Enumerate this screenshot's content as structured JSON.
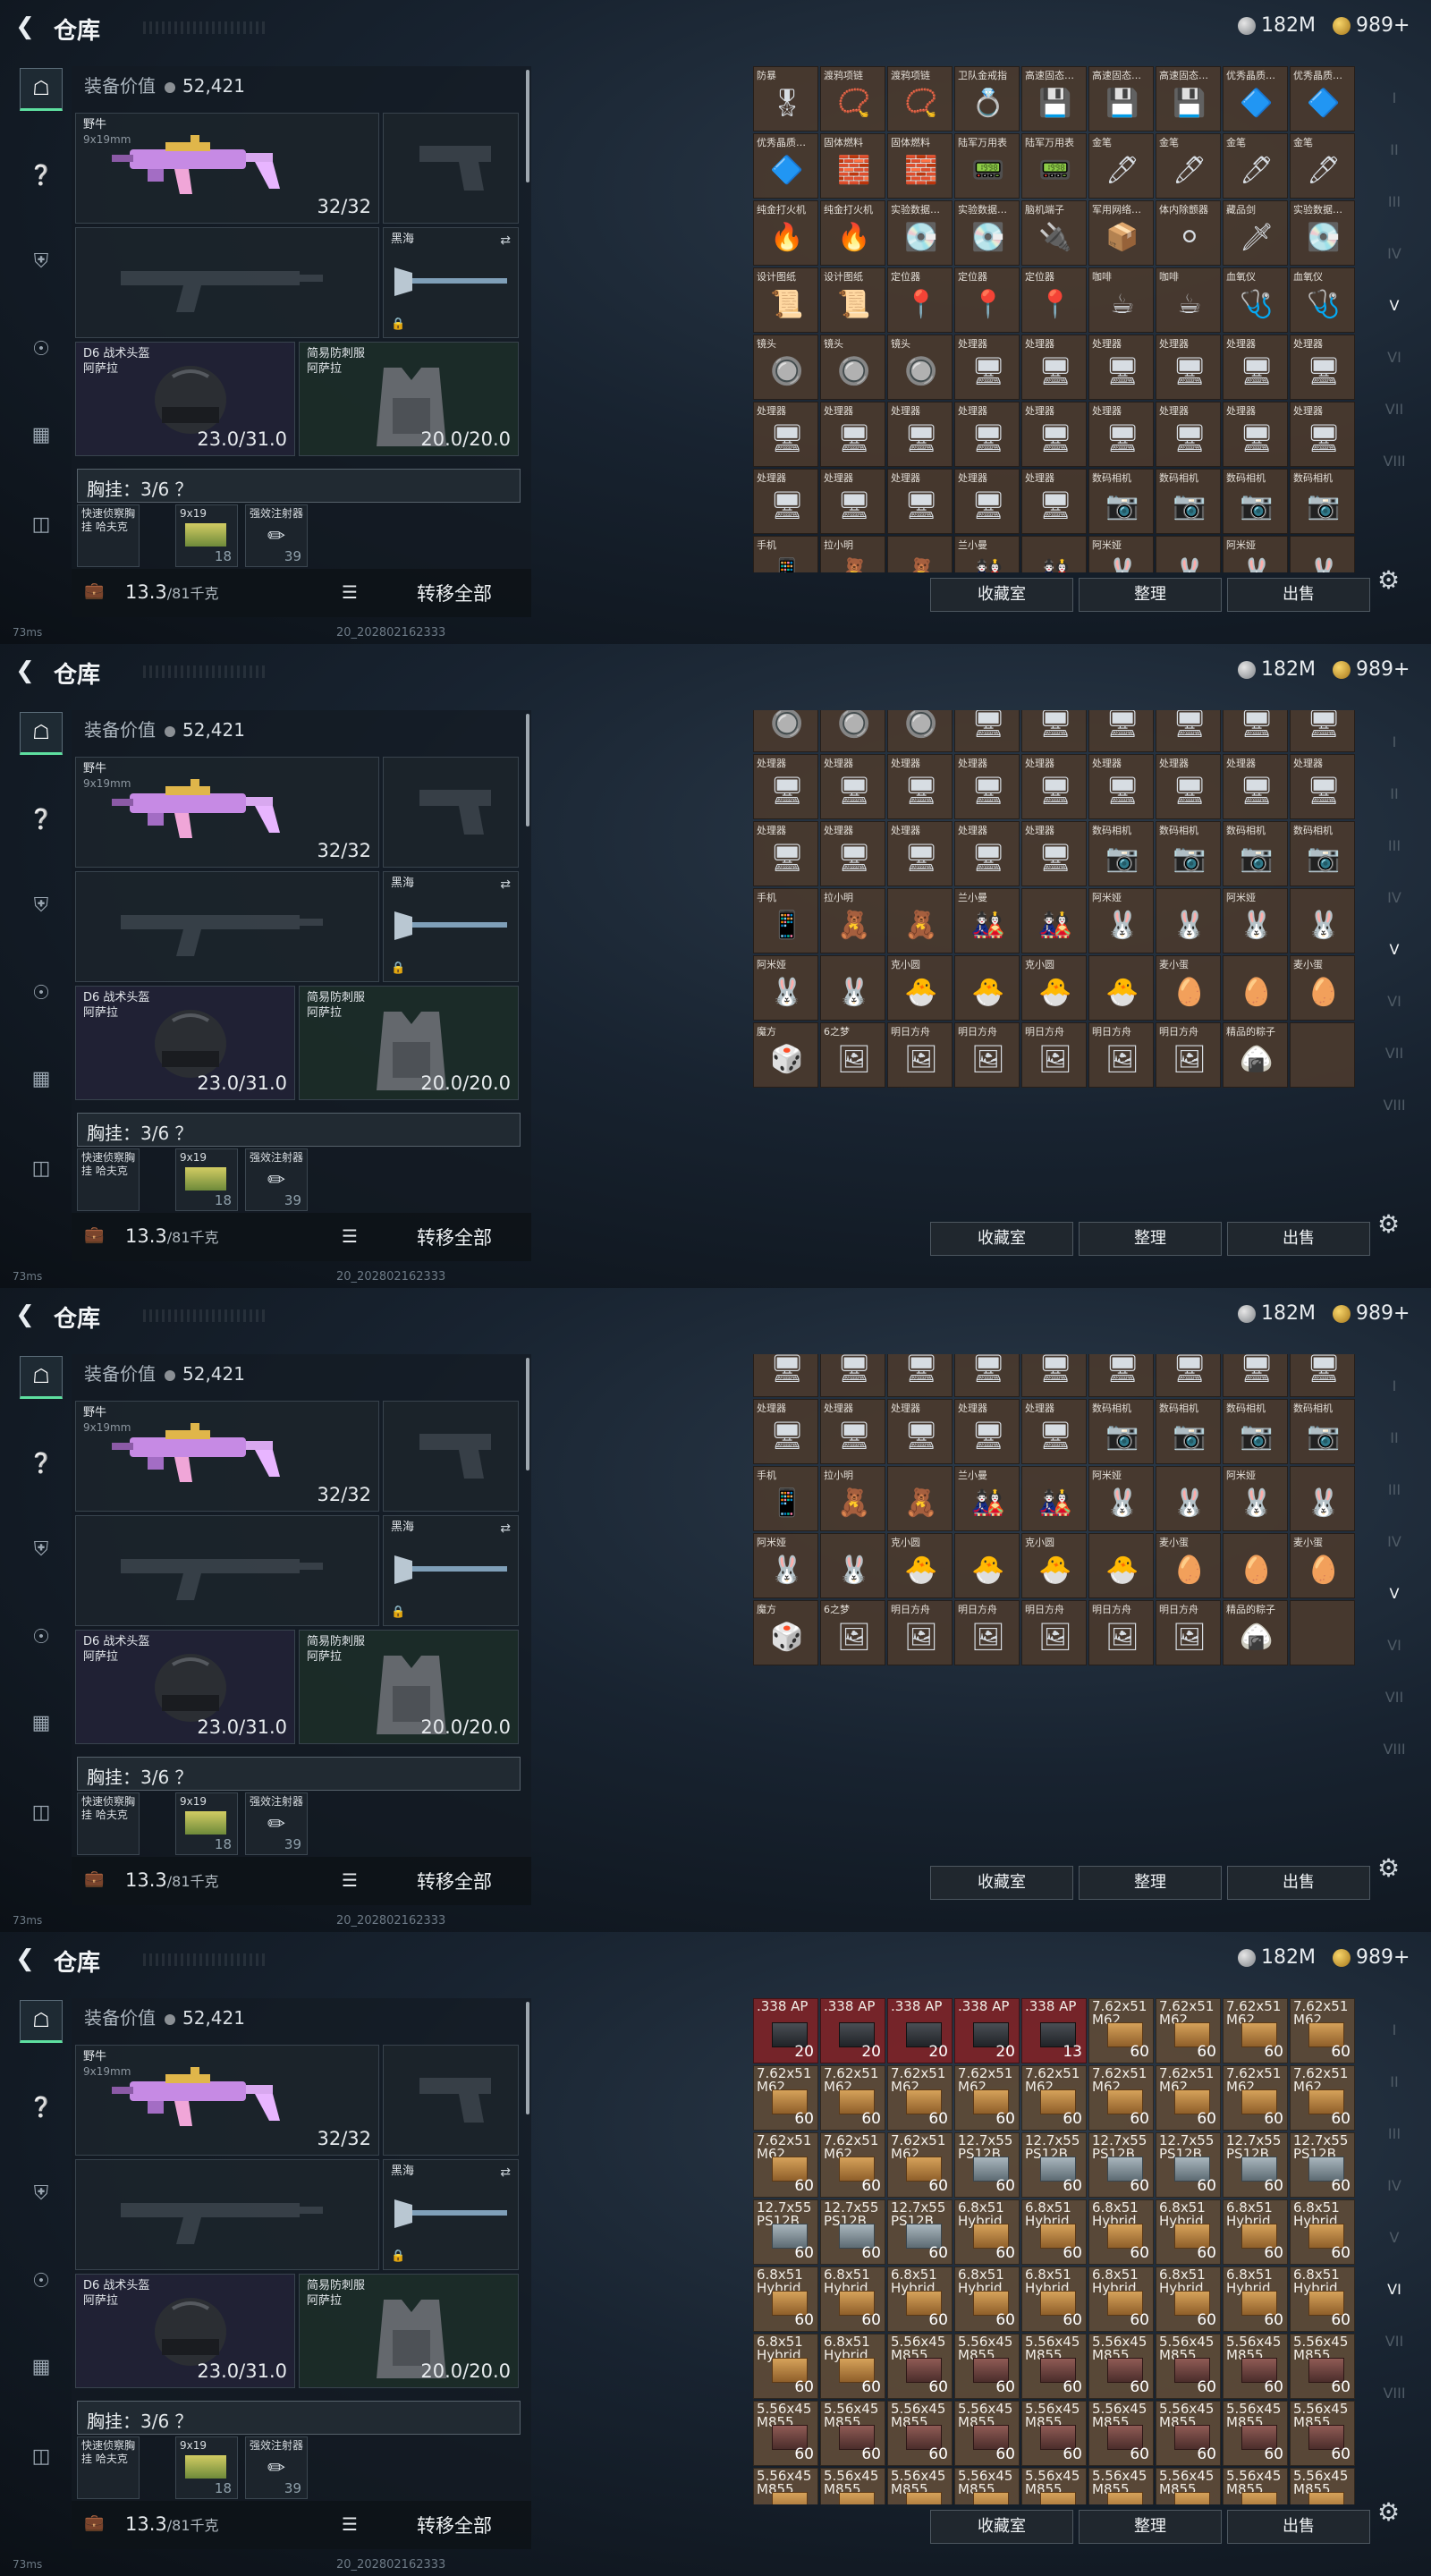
{
  "screens": [
    {
      "id": "s1"
    },
    {
      "id": "s2"
    },
    {
      "id": "s3"
    },
    {
      "id": "s4"
    }
  ],
  "header": {
    "title": "仓库",
    "silver": "182M",
    "gold": "989+"
  },
  "loadout": {
    "value_label": "装备价值",
    "value": "52,421",
    "primary": {
      "name": "野牛",
      "sub": "9x19mm",
      "ammo": "32/32"
    },
    "melee": {
      "name": "黑海"
    },
    "helmet": {
      "name": "D6 战术头盔",
      "sub": "阿萨拉",
      "durability": "23.0/31.0"
    },
    "armor": {
      "name": "简易防刺服",
      "sub": "阿萨拉",
      "durability": "20.0/20.0"
    },
    "chest": "胸挂：3/6 ？",
    "pouches": [
      {
        "name": "快速侦察胸挂 哈夫克",
        "count": ""
      },
      {
        "name": "9x19",
        "count": "18"
      },
      {
        "name": "强效注射器",
        "count": "39"
      }
    ],
    "weight": "13.3",
    "weight_unit": "/81千克",
    "transfer_all": "转移全部"
  },
  "actions": {
    "collection": "收藏室",
    "sort": "整理",
    "sell": "出售"
  },
  "status": {
    "ping": "73ms",
    "build": "20_202802162333"
  },
  "grid1_rows": [
    [
      [
        "防暴",
        "🎖"
      ],
      [
        "渡鸦项链",
        "📿"
      ],
      [
        "渡鸦项链",
        "📿"
      ],
      [
        "卫队金戒指",
        "💍"
      ],
      [
        "高速固态…",
        "💾"
      ],
      [
        "高速固态…",
        "💾"
      ],
      [
        "高速固态…",
        "💾"
      ],
      [
        "优秀晶质…",
        "🔷"
      ],
      [
        "优秀晶质…",
        "🔷"
      ]
    ],
    [
      [
        "优秀晶质…",
        "🔷"
      ],
      [
        "固体燃料",
        "🧱"
      ],
      [
        "固体燃料",
        "🧱"
      ],
      [
        "陆军万用表",
        "📟"
      ],
      [
        "陆军万用表",
        "📟"
      ],
      [
        "金笔",
        "🖊"
      ],
      [
        "金笔",
        "🖊"
      ],
      [
        "金笔",
        "🖊"
      ],
      [
        "金笔",
        "🖊"
      ]
    ],
    [
      [
        "纯金打火机",
        "🔥"
      ],
      [
        "纯金打火机",
        "🔥"
      ],
      [
        "实验数据…",
        "💽"
      ],
      [
        "实验数据…",
        "💽"
      ],
      [
        "脑机端子",
        "🔌"
      ],
      [
        "军用网络…",
        "📦"
      ],
      [
        "体内除颤器",
        "⚪"
      ],
      [
        "藏品剑",
        "🗡"
      ],
      [
        "实验数据…",
        "💽"
      ]
    ],
    [
      [
        "设计图纸",
        "📜"
      ],
      [
        "设计图纸",
        "📜"
      ],
      [
        "定位器",
        "📍"
      ],
      [
        "定位器",
        "📍"
      ],
      [
        "定位器",
        "📍"
      ],
      [
        "咖啡",
        "☕"
      ],
      [
        "咖啡",
        "☕"
      ],
      [
        "血氧仪",
        "🩺"
      ],
      [
        "血氧仪",
        "🩺"
      ]
    ],
    [
      [
        "镜头",
        "🔘"
      ],
      [
        "镜头",
        "🔘"
      ],
      [
        "镜头",
        "🔘"
      ],
      [
        "处理器",
        "🖥"
      ],
      [
        "处理器",
        "🖥"
      ],
      [
        "处理器",
        "🖥"
      ],
      [
        "处理器",
        "🖥"
      ],
      [
        "处理器",
        "🖥"
      ],
      [
        "处理器",
        "🖥"
      ]
    ],
    [
      [
        "处理器",
        "🖥"
      ],
      [
        "处理器",
        "🖥"
      ],
      [
        "处理器",
        "🖥"
      ],
      [
        "处理器",
        "🖥"
      ],
      [
        "处理器",
        "🖥"
      ],
      [
        "处理器",
        "🖥"
      ],
      [
        "处理器",
        "🖥"
      ],
      [
        "处理器",
        "🖥"
      ],
      [
        "处理器",
        "🖥"
      ]
    ],
    [
      [
        "处理器",
        "🖥"
      ],
      [
        "处理器",
        "🖥"
      ],
      [
        "处理器",
        "🖥"
      ],
      [
        "处理器",
        "🖥"
      ],
      [
        "处理器",
        "🖥"
      ],
      [
        "数码相机",
        "📷"
      ],
      [
        "数码相机",
        "📷"
      ],
      [
        "数码相机",
        "📷"
      ],
      [
        "数码相机",
        "📷"
      ]
    ],
    [
      [
        "手机",
        "📱"
      ],
      [
        "拉小明",
        "🧸"
      ],
      [
        "",
        "🧸"
      ],
      [
        "兰小曼",
        "🎎"
      ],
      [
        "",
        "🎎"
      ],
      [
        "阿米娅",
        "🐰"
      ],
      [
        "",
        "🐰"
      ],
      [
        "阿米娅",
        "🐰"
      ],
      [
        "",
        "🐰"
      ]
    ]
  ],
  "grid2_rows": [
    [
      [
        "镜头",
        "🔘"
      ],
      [
        "镜头",
        "🔘"
      ],
      [
        "镜头",
        "🔘"
      ],
      [
        "处理器",
        "🖥"
      ],
      [
        "处理器",
        "🖥"
      ],
      [
        "处理器",
        "🖥"
      ],
      [
        "处理器",
        "🖥"
      ],
      [
        "处理器",
        "🖥"
      ],
      [
        "处理器",
        "🖥"
      ]
    ],
    [
      [
        "处理器",
        "🖥"
      ],
      [
        "处理器",
        "🖥"
      ],
      [
        "处理器",
        "🖥"
      ],
      [
        "处理器",
        "🖥"
      ],
      [
        "处理器",
        "🖥"
      ],
      [
        "处理器",
        "🖥"
      ],
      [
        "处理器",
        "🖥"
      ],
      [
        "处理器",
        "🖥"
      ],
      [
        "处理器",
        "🖥"
      ]
    ],
    [
      [
        "处理器",
        "🖥"
      ],
      [
        "处理器",
        "🖥"
      ],
      [
        "处理器",
        "🖥"
      ],
      [
        "处理器",
        "🖥"
      ],
      [
        "处理器",
        "🖥"
      ],
      [
        "数码相机",
        "📷"
      ],
      [
        "数码相机",
        "📷"
      ],
      [
        "数码相机",
        "📷"
      ],
      [
        "数码相机",
        "📷"
      ]
    ],
    [
      [
        "手机",
        "📱"
      ],
      [
        "拉小明",
        "🧸"
      ],
      [
        "",
        "🧸"
      ],
      [
        "兰小曼",
        "🎎"
      ],
      [
        "",
        "🎎"
      ],
      [
        "阿米娅",
        "🐰"
      ],
      [
        "",
        "🐰"
      ],
      [
        "阿米娅",
        "🐰"
      ],
      [
        "",
        "🐰"
      ]
    ],
    [
      [
        "阿米娅",
        "🐰"
      ],
      [
        "",
        "🐰"
      ],
      [
        "克小圆",
        "🐣"
      ],
      [
        "",
        "🐣"
      ],
      [
        "克小圆",
        "🐣"
      ],
      [
        "",
        "🐣"
      ],
      [
        "麦小蛋",
        "🥚"
      ],
      [
        "",
        "🥚"
      ],
      [
        "麦小蛋",
        "🥚"
      ]
    ],
    [
      [
        "魔方",
        "🎲"
      ],
      [
        "6之梦",
        "🖼"
      ],
      [
        "明日方舟",
        "🖼"
      ],
      [
        "明日方舟",
        "🖼"
      ],
      [
        "明日方舟",
        "🖼"
      ],
      [
        "明日方舟",
        "🖼"
      ],
      [
        "明日方舟",
        "🖼"
      ],
      [
        "精品的粽子",
        "🍙"
      ],
      [
        "",
        ""
      ]
    ]
  ],
  "grid4_rows": [
    [
      [
        ".338 AP",
        "20",
        "dark"
      ],
      [
        ".338 AP",
        "20",
        "dark"
      ],
      [
        ".338 AP",
        "20",
        "dark"
      ],
      [
        ".338 AP",
        "20",
        "dark"
      ],
      [
        ".338 AP",
        "13",
        "dark"
      ],
      [
        "7.62x51 M62",
        "60",
        ""
      ],
      [
        "7.62x51 M62",
        "60",
        ""
      ],
      [
        "7.62x51 M62",
        "60",
        ""
      ],
      [
        "7.62x51 M62",
        "60",
        ""
      ]
    ],
    [
      [
        "7.62x51 M62",
        "60",
        ""
      ],
      [
        "7.62x51 M62",
        "60",
        ""
      ],
      [
        "7.62x51 M62",
        "60",
        ""
      ],
      [
        "7.62x51 M62",
        "60",
        ""
      ],
      [
        "7.62x51 M62",
        "60",
        ""
      ],
      [
        "7.62x51 M62",
        "60",
        ""
      ],
      [
        "7.62x51 M62",
        "60",
        ""
      ],
      [
        "7.62x51 M62",
        "60",
        ""
      ],
      [
        "7.62x51 M62",
        "60",
        ""
      ]
    ],
    [
      [
        "7.62x51 M62",
        "60",
        ""
      ],
      [
        "7.62x51 M62",
        "60",
        ""
      ],
      [
        "7.62x51 M62",
        "60",
        ""
      ],
      [
        "12.7x55 PS12B",
        "60",
        "silver"
      ],
      [
        "12.7x55 PS12B",
        "60",
        "silver"
      ],
      [
        "12.7x55 PS12B",
        "60",
        "silver"
      ],
      [
        "12.7x55 PS12B",
        "60",
        "silver"
      ],
      [
        "12.7x55 PS12B",
        "60",
        "silver"
      ],
      [
        "12.7x55 PS12B",
        "60",
        "silver"
      ]
    ],
    [
      [
        "12.7x55 PS12B",
        "60",
        "silver"
      ],
      [
        "12.7x55 PS12B",
        "60",
        "silver"
      ],
      [
        "12.7x55 PS12B",
        "60",
        "silver"
      ],
      [
        "6.8x51 Hybrid",
        "60",
        ""
      ],
      [
        "6.8x51 Hybrid",
        "60",
        ""
      ],
      [
        "6.8x51 Hybrid",
        "60",
        ""
      ],
      [
        "6.8x51 Hybrid",
        "60",
        ""
      ],
      [
        "6.8x51 Hybrid",
        "60",
        ""
      ],
      [
        "6.8x51 Hybrid",
        "60",
        ""
      ]
    ],
    [
      [
        "6.8x51 Hybrid",
        "60",
        ""
      ],
      [
        "6.8x51 Hybrid",
        "60",
        ""
      ],
      [
        "6.8x51 Hybrid",
        "60",
        ""
      ],
      [
        "6.8x51 Hybrid",
        "60",
        ""
      ],
      [
        "6.8x51 Hybrid",
        "60",
        ""
      ],
      [
        "6.8x51 Hybrid",
        "60",
        ""
      ],
      [
        "6.8x51 Hybrid",
        "60",
        ""
      ],
      [
        "6.8x51 Hybrid",
        "60",
        ""
      ],
      [
        "6.8x51 Hybrid",
        "60",
        ""
      ]
    ],
    [
      [
        "6.8x51 Hybrid",
        "60",
        ""
      ],
      [
        "6.8x51 Hybrid",
        "60",
        ""
      ],
      [
        "5.56x45 M855",
        "60",
        "red"
      ],
      [
        "5.56x45 M855",
        "60",
        "red"
      ],
      [
        "5.56x45 M855",
        "60",
        "red"
      ],
      [
        "5.56x45 M855",
        "60",
        "red"
      ],
      [
        "5.56x45 M855",
        "60",
        "red"
      ],
      [
        "5.56x45 M855",
        "60",
        "red"
      ],
      [
        "5.56x45 M855",
        "60",
        "red"
      ]
    ],
    [
      [
        "5.56x45 M855",
        "60",
        "red"
      ],
      [
        "5.56x45 M855",
        "60",
        "red"
      ],
      [
        "5.56x45 M855",
        "60",
        "red"
      ],
      [
        "5.56x45 M855",
        "60",
        "red"
      ],
      [
        "5.56x45 M855",
        "60",
        "red"
      ],
      [
        "5.56x45 M855",
        "60",
        "red"
      ],
      [
        "5.56x45 M855",
        "60",
        "red"
      ],
      [
        "5.56x45 M855",
        "60",
        "red"
      ],
      [
        "5.56x45 M855",
        "60",
        "red"
      ]
    ],
    [
      [
        "5.56x45 M855",
        "",
        ""
      ],
      [
        "5.56x45 M855",
        "",
        ""
      ],
      [
        "5.56x45 M855",
        "",
        ""
      ],
      [
        "5.56x45 M855",
        "",
        ""
      ],
      [
        "5.56x45 M855",
        "",
        ""
      ],
      [
        "5.56x45 M855",
        "",
        ""
      ],
      [
        "5.56x45 M855",
        "",
        ""
      ],
      [
        "5.56x45 M855",
        "",
        ""
      ],
      [
        "5.56x45 M855",
        "",
        ""
      ]
    ]
  ],
  "right_nav": {
    "tabs": [
      "I",
      "II",
      "III",
      "IV",
      "V",
      "VI",
      "VII",
      "VIII"
    ]
  },
  "colors": {
    "accent": "#5ee0a0",
    "cell": "#4a3a2e",
    "ammo_red": "#7a2428"
  }
}
